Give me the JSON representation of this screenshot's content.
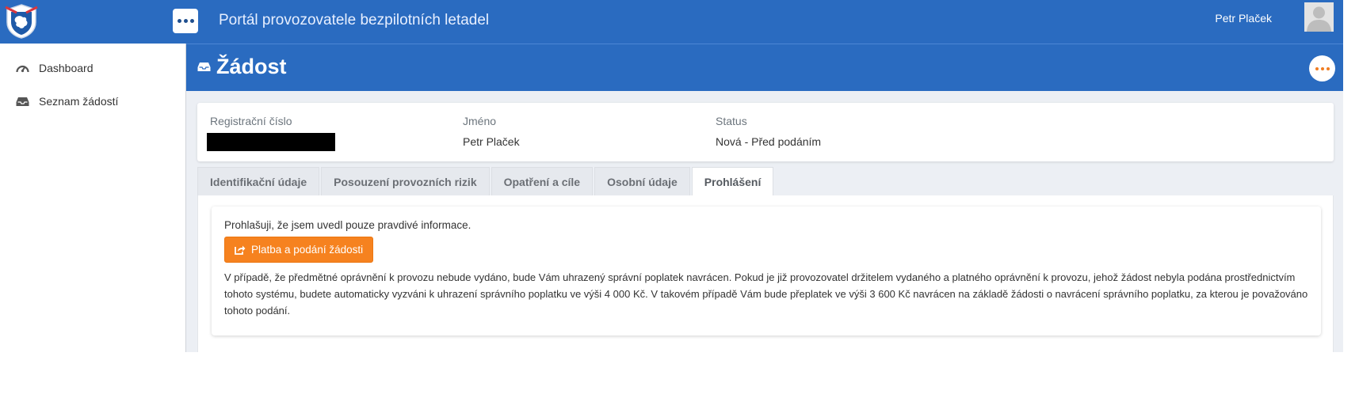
{
  "header": {
    "portal_title": "Portál provozovatele bezpilotních letadel",
    "user_name": "Petr Plaček"
  },
  "sidebar": {
    "items": [
      {
        "label": "Dashboard",
        "icon": "dashboard-gauge-icon"
      },
      {
        "label": "Seznam žádostí",
        "icon": "inbox-tray-icon"
      }
    ]
  },
  "page": {
    "title": "Žádost"
  },
  "info": {
    "registration_label": "Registrační číslo",
    "name_label": "Jméno",
    "name_value": "Petr Plaček",
    "status_label": "Status",
    "status_value": "Nová - Před podáním"
  },
  "tabs": [
    {
      "label": "Identifikační údaje"
    },
    {
      "label": "Posouzení provozních rizik"
    },
    {
      "label": "Opatření a cíle"
    },
    {
      "label": "Osobní údaje"
    },
    {
      "label": "Prohlášení",
      "active": true
    }
  ],
  "declaration": {
    "statement": "Prohlašuji, že jsem uvedl pouze pravdivé informace.",
    "submit_label": "Platba a podání žádosti",
    "note": "V případě, že předmětné oprávnění k provozu nebude vydáno, bude Vám uhrazený správní poplatek navrácen. Pokud je již provozovatel držitelem vydaného a platného oprávnění k provozu, jehož žádost nebyla podána prostřednictvím tohoto systému, budete automaticky vyzváni k uhrazení správního poplatku ve výši 4 000 Kč. V takovém případě Vám bude přeplatek ve výši 3 600 Kč navrácen na základě žádosti o navrácení správního poplatku, za kterou je považováno tohoto podání."
  },
  "colors": {
    "primary": "#2a6bc0",
    "accent": "#f6821f"
  }
}
